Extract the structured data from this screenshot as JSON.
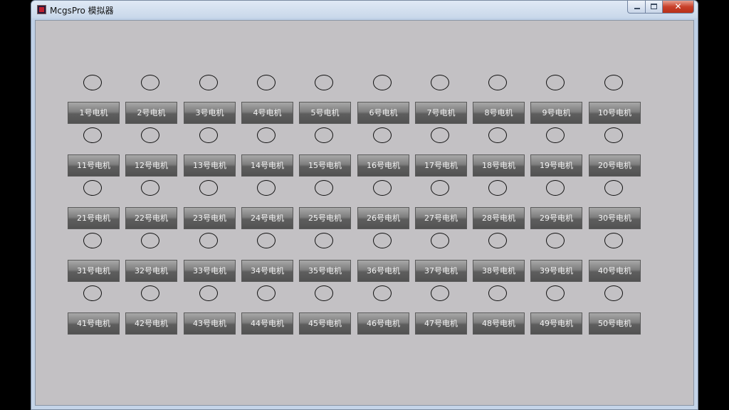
{
  "window": {
    "title": "McgsPro 模拟器",
    "close_glyph": "✕"
  },
  "motors": [
    {
      "label": "1号电机"
    },
    {
      "label": "2号电机"
    },
    {
      "label": "3号电机"
    },
    {
      "label": "4号电机"
    },
    {
      "label": "5号电机"
    },
    {
      "label": "6号电机"
    },
    {
      "label": "7号电机"
    },
    {
      "label": "8号电机"
    },
    {
      "label": "9号电机"
    },
    {
      "label": "10号电机"
    },
    {
      "label": "11号电机"
    },
    {
      "label": "12号电机"
    },
    {
      "label": "13号电机"
    },
    {
      "label": "14号电机"
    },
    {
      "label": "15号电机"
    },
    {
      "label": "16号电机"
    },
    {
      "label": "17号电机"
    },
    {
      "label": "18号电机"
    },
    {
      "label": "19号电机"
    },
    {
      "label": "20号电机"
    },
    {
      "label": "21号电机"
    },
    {
      "label": "22号电机"
    },
    {
      "label": "23号电机"
    },
    {
      "label": "24号电机"
    },
    {
      "label": "25号电机"
    },
    {
      "label": "26号电机"
    },
    {
      "label": "27号电机"
    },
    {
      "label": "28号电机"
    },
    {
      "label": "29号电机"
    },
    {
      "label": "30号电机"
    },
    {
      "label": "31号电机"
    },
    {
      "label": "32号电机"
    },
    {
      "label": "33号电机"
    },
    {
      "label": "34号电机"
    },
    {
      "label": "35号电机"
    },
    {
      "label": "36号电机"
    },
    {
      "label": "37号电机"
    },
    {
      "label": "38号电机"
    },
    {
      "label": "39号电机"
    },
    {
      "label": "40号电机"
    },
    {
      "label": "41号电机"
    },
    {
      "label": "42号电机"
    },
    {
      "label": "43号电机"
    },
    {
      "label": "44号电机"
    },
    {
      "label": "45号电机"
    },
    {
      "label": "46号电机"
    },
    {
      "label": "47号电机"
    },
    {
      "label": "48号电机"
    },
    {
      "label": "49号电机"
    },
    {
      "label": "50号电机"
    }
  ],
  "colors": {
    "panel_background": "#c3c1c4",
    "button_gray": "#6e6e6e",
    "indicator_stroke": "#111111"
  }
}
